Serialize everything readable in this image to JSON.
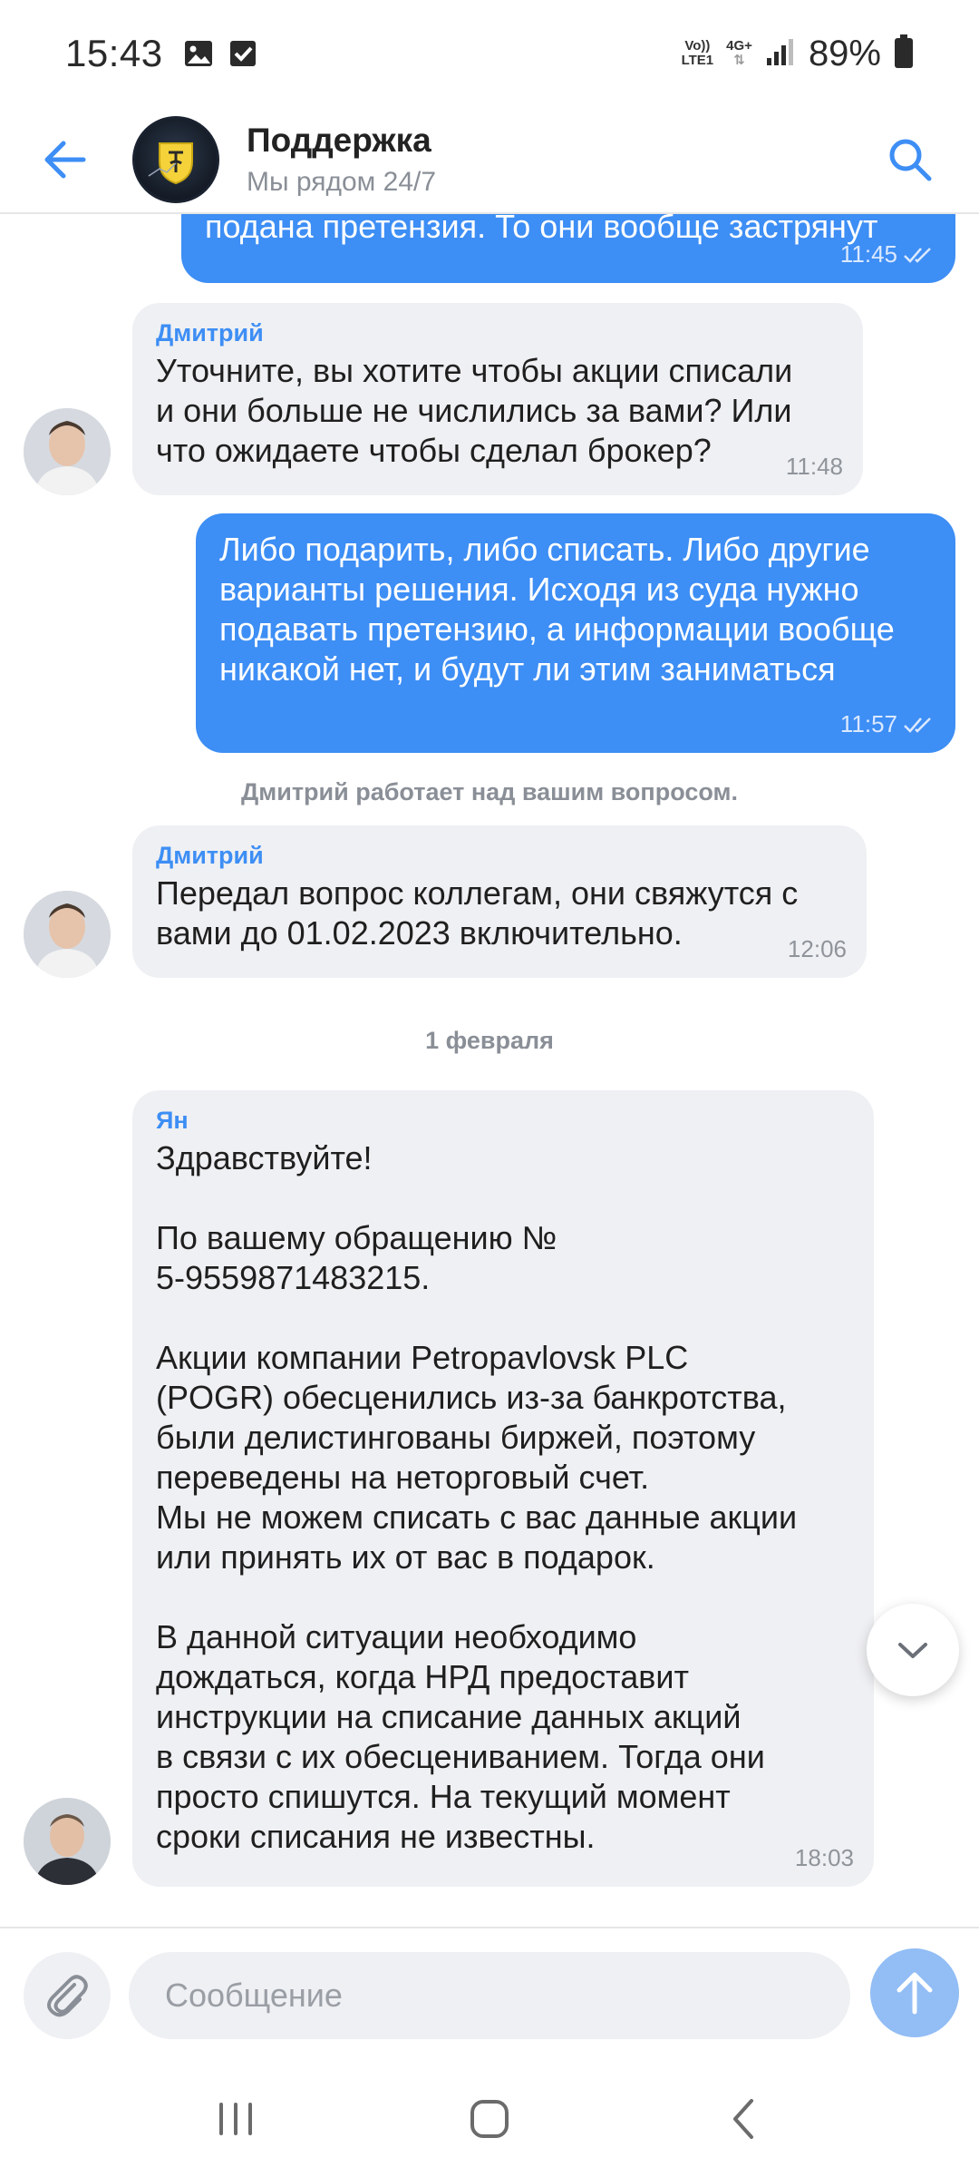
{
  "status_bar": {
    "time": "15:43",
    "volte_line1": "Vo))",
    "volte_line2": "LTE1",
    "network": "4G+",
    "battery": "89%"
  },
  "header": {
    "title": "Поддержка",
    "subtitle": "Мы рядом 24/7",
    "accent_color": "#3d8ef5"
  },
  "messages": [
    {
      "direction": "out",
      "text": "подана претензия. То они вообще застрянут",
      "time": "11:45"
    },
    {
      "direction": "in",
      "sender": "Дмитрий",
      "text": "Уточните, вы хотите чтобы акции списали\nи они больше не числились за вами? Или\nчто ожидаете чтобы сделал брокер?",
      "time": "11:48"
    },
    {
      "direction": "out",
      "text": "Либо подарить, либо списать. Либо другие\nварианты решения. Исходя из суда нужно\nподавать претензию, а информации вообще\nникакой нет, и будут ли этим заниматься",
      "time": "11:57"
    },
    {
      "direction": "in",
      "sender": "Дмитрий",
      "text": "Передал вопрос коллегам, они свяжутся с\nвами до 01.02.2023 включительно.",
      "time": "12:06"
    },
    {
      "direction": "in",
      "sender": "Ян",
      "text": "Здравствуйте!\n\nПо вашему обращению №\n5-9559871483215.\n\nАкции компании Petropavlovsk PLC\n(POGR) обесценились из-за банкротства,\nбыли делистингованы биржей, поэтому\nпереведены на неторговый счет.\nМы не можем списать с вас данные акции\nили принять их от вас в подарок.\n\nВ данной ситуации необходимо\nдождаться, когда НРД предоставит\nинструкции на списание данных акций\nв связи с их обесцениванием. Тогда они\nпросто спишутся. На текущий момент\nсроки списания не известны.",
      "time": "18:03"
    }
  ],
  "system_note": "Дмитрий работает над вашим вопросом.",
  "date_separator": "1 февраля",
  "composer": {
    "placeholder": "Сообщение"
  }
}
